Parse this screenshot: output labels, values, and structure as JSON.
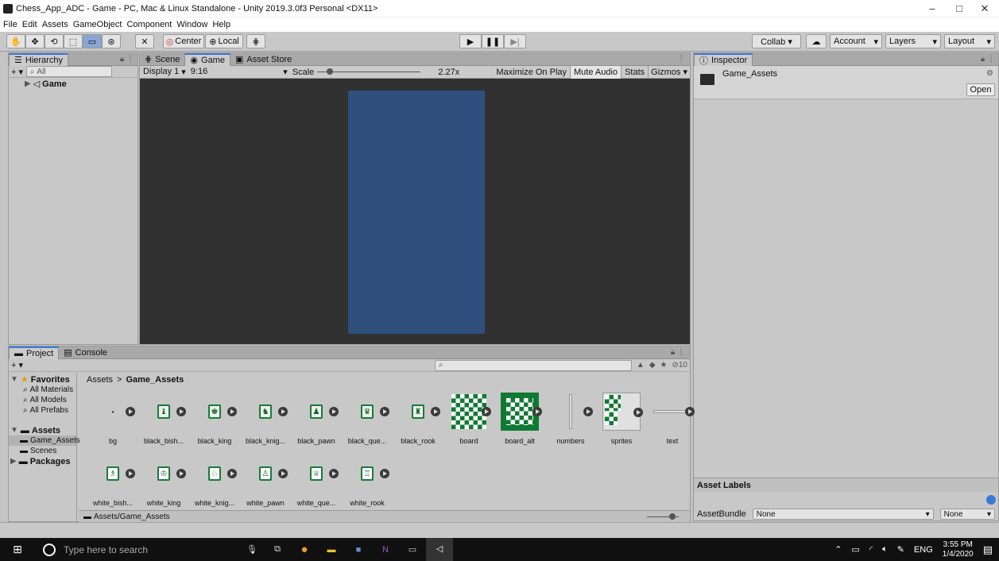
{
  "window": {
    "title": "Chess_App_ADC - Game - PC, Mac & Linux Standalone - Unity 2019.3.0f3 Personal <DX11>",
    "controls": {
      "minimize": "–",
      "maximize": "□",
      "close": "✕"
    }
  },
  "menu": [
    "File",
    "Edit",
    "Assets",
    "GameObject",
    "Component",
    "Window",
    "Help"
  ],
  "toolbar": {
    "pivot_label": "Center",
    "space_label": "Local",
    "collab_label": "Collab ▾",
    "account_label": "Account",
    "layers_label": "Layers",
    "layout_label": "Layout"
  },
  "hierarchy": {
    "tab_label": "Hierarchy",
    "add_label": "+ ▾",
    "search_placeholder": "All",
    "scene_name": "Game"
  },
  "center_tabs": {
    "scene": "Scene",
    "game": "Game",
    "asset_store": "Asset Store"
  },
  "gameview": {
    "display_label": "Display 1",
    "aspect_label": "9:16",
    "scale_label": "Scale",
    "scale_value": "2.27x",
    "maximize_label": "Maximize On Play",
    "mute_label": "Mute Audio",
    "stats_label": "Stats",
    "gizmos_label": "Gizmos",
    "canvas_color": "#2f4f7d"
  },
  "inspector": {
    "tab_label": "Inspector",
    "asset_name": "Game_Assets",
    "open_label": "Open",
    "labels_title": "Asset Labels",
    "bundle_label": "AssetBundle",
    "bundle_value": "None",
    "variant_value": "None"
  },
  "project": {
    "tab_label": "Project",
    "console_label": "Console",
    "add_label": "+ ▾",
    "hidden_count": "10",
    "breadcrumb_root": "Assets",
    "breadcrumb_sep": ">",
    "breadcrumb_current": "Game_Assets",
    "path": "Assets/Game_Assets",
    "tree": {
      "favorites": "Favorites",
      "fav_items": [
        "All Materials",
        "All Models",
        "All Prefabs"
      ],
      "assets": "Assets",
      "asset_items": [
        "Game_Assets",
        "Scenes"
      ],
      "packages": "Packages"
    },
    "row1": [
      "bg",
      "black_bish...",
      "black_king",
      "black_knig...",
      "black_pawn",
      "black_que...",
      "black_rook",
      "board",
      "board_alt",
      "numbers",
      "sprites",
      "text"
    ],
    "row2": [
      "white_bish...",
      "white_king",
      "white_knig...",
      "white_pawn",
      "white_que...",
      "white_rook"
    ]
  },
  "taskbar": {
    "search_placeholder": "Type here to search",
    "lang": "ENG",
    "time": "3:55 PM",
    "date": "1/4/2020"
  }
}
